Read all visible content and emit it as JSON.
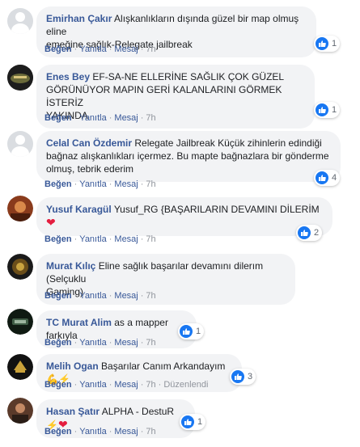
{
  "actions": {
    "like": "Beğen",
    "reply": "Yanıtla",
    "message": "Mesaj",
    "dot": "·",
    "edited": "Düzenlendi"
  },
  "comments": [
    {
      "name": "Emirhan Çakır",
      "text1": "Alışkanlıkların dışında güzel bir map olmuş eline",
      "text2": "emeğine sağlık-Relegate jailbreak",
      "text3": "",
      "reactions": "1",
      "time": "7h"
    },
    {
      "name": "Enes Bey",
      "text1": "EF-SA-NE ELLERİNE SAĞLIK ÇOK GÜZEL",
      "text2": "GÖRÜNÜYOR MAPIN GERİ KALANLARINI GÖRMEK İSTERİZ",
      "text3": "YAKINDA",
      "reactions": "1",
      "time": "7h"
    },
    {
      "name": "Celal Can Özdemir",
      "text1": "Relegate Jailbreak Küçük zihinlerin edindiği",
      "text2": "bağnaz alışkanlıkları içermez. Bu mapte bağnazlara bir gönderme",
      "text3": "olmuş, tebrik ederim",
      "reactions": "4",
      "time": "7h"
    },
    {
      "name": "Yusuf Karagül",
      "text1": "Yusuf_RG {BAŞARILARIN DEVAMINI DİLERİM",
      "reactions": "2",
      "time": "7h"
    },
    {
      "name": "Murat Kılıç",
      "text1": "Eline sağlık başarılar devamını dilerım (Selçuklu",
      "text2": "Gaming)",
      "reactions": "",
      "time": "7h"
    },
    {
      "name": "TC Murat Alim",
      "text1": "as a mapper farkıyla",
      "reactions": "1",
      "time": "7h"
    },
    {
      "name": "Melih Ogan",
      "text1": "Başarılar Canım Arkandayım",
      "reactions": "3",
      "time": "7h"
    },
    {
      "name": "Hasan Şatır",
      "text1": "ALPHA - DestuR",
      "reactions": "1",
      "time": "7h"
    }
  ],
  "colors": {
    "name": "#385898",
    "bubble": "#f2f3f5",
    "like": "#1877f2",
    "meta": "#90949c"
  },
  "icons": {
    "like": "thumbs-up-icon",
    "heart": "heart-emoji-icon",
    "muscle": "flexed-biceps-emoji-icon",
    "bolt": "high-voltage-emoji-icon"
  }
}
